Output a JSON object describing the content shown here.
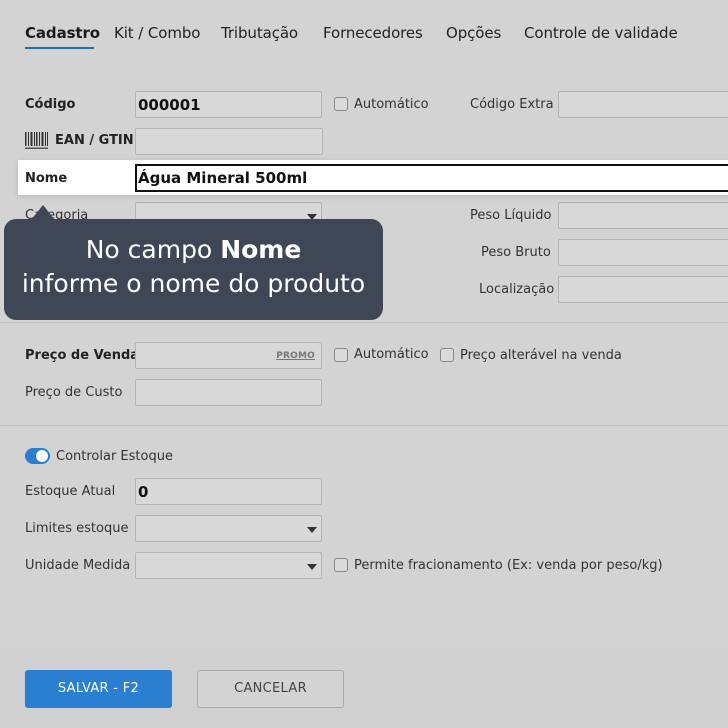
{
  "tabs": [
    {
      "label": "Cadastro",
      "active": true
    },
    {
      "label": "Kit / Combo"
    },
    {
      "label": "Tributação"
    },
    {
      "label": "Fornecedores"
    },
    {
      "label": "Opções"
    },
    {
      "label": "Controle de validade"
    }
  ],
  "fields": {
    "codigo": {
      "label": "Código",
      "value": "000001"
    },
    "automatico_codigo": {
      "label": "Automático"
    },
    "codigo_extra": {
      "label": "Código Extra",
      "value": ""
    },
    "ean": {
      "label": "EAN / GTIN",
      "value": ""
    },
    "nome": {
      "label": "Nome",
      "value": "Água Mineral 500ml"
    },
    "categoria": {
      "label": "Categoria",
      "value": ""
    },
    "peso_liquido": {
      "label": "Peso Líquido",
      "value": ""
    },
    "peso_bruto": {
      "label": "Peso Bruto",
      "value": ""
    },
    "localizacao": {
      "label": "Localização",
      "value": ""
    },
    "preco_venda": {
      "label": "Preço de Venda",
      "value": "",
      "promo": "PROMO"
    },
    "automatico_preco": {
      "label": "Automático"
    },
    "preco_alteravel": {
      "label": "Preço alterável na venda"
    },
    "preco_custo": {
      "label": "Preço de Custo",
      "value": ""
    },
    "controlar_estoque": {
      "label": "Controlar Estoque",
      "on": true
    },
    "estoque_atual": {
      "label": "Estoque Atual",
      "value": "0"
    },
    "limites_estoque": {
      "label": "Limites estoque",
      "value": ""
    },
    "unidade_medida": {
      "label": "Unidade Medida",
      "value": ""
    },
    "permite_fracionamento": {
      "label": "Permite fracionamento (Ex: venda por peso/kg)"
    }
  },
  "tooltip": {
    "line1_prefix": "No campo ",
    "line1_bold": "Nome",
    "line2": "informe o nome do produto"
  },
  "buttons": {
    "save": "SALVAR - F2",
    "cancel": "CANCELAR"
  },
  "colors": {
    "accent": "#2a7fd0",
    "tooltip_bg": "#3f4757",
    "overlay_bg": "#d3d3d3"
  }
}
